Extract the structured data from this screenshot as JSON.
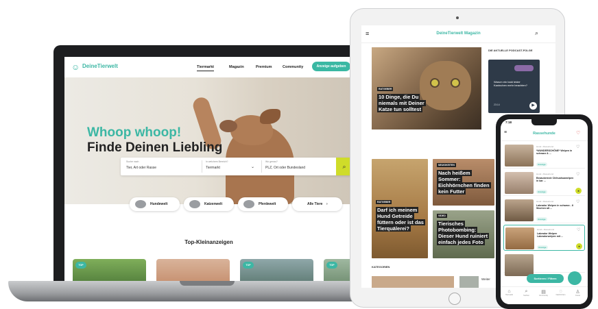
{
  "laptop": {
    "logo": "DeineTierwelt",
    "nav": [
      "Tiermarkt",
      "Magazin",
      "Premium",
      "Community"
    ],
    "cta": "Anzeige aufgeben",
    "hero": {
      "line1": "Whoop whoop!",
      "line2": "Finde Deinen Liebling"
    },
    "search": {
      "fields": [
        {
          "label": "Suche nach",
          "value": "Tier, Art oder Rasse"
        },
        {
          "label": "In welchem Bereich?",
          "value": "Tiermarkt"
        },
        {
          "label": "Wo genau?",
          "value": "PLZ, Ort oder Bundesland"
        }
      ],
      "button_icon": "search-icon"
    },
    "categories": [
      "Hundewelt",
      "Katzenwelt",
      "Pferdewelt",
      "Alle Tiere"
    ],
    "section_title": "Top-Kleinanzeigen",
    "thumb_badge": "TOP"
  },
  "tablet": {
    "title": "DeineTierwelt Magazin",
    "main_article": {
      "tag": "RATGEBER",
      "headline": "10 Dinge, die Du niemals mit Deiner Katze tun solltest"
    },
    "podcast": {
      "label": "DIE AKTUELLE PODCAST-FOLGE",
      "text": "Warum ein bald leider Kaninchen mehr beachten?",
      "time": "23:14"
    },
    "cards": [
      {
        "tag": "RATGEBER",
        "headline": "Darf ich meinem Hund Getreide füttern oder ist das Tierquälerei?"
      },
      {
        "tag": "NEUIGKEITEN",
        "headline": "Nach heißem Sommer: Eichhörnchen finden kein Futter"
      },
      {
        "tag": "VIDEO",
        "headline": "Tierisches Photobombing: Dieser Hund ruiniert einfach jedes Foto"
      }
    ],
    "categories_label": "KATEGORIEN",
    "bottom_text": "Weiter"
  },
  "phone": {
    "time": "7:18",
    "title": "Rassehunde",
    "items": [
      {
        "meta": "Hund • Rassehund",
        "text": "*WUNDERSCHÖNE* Welpen in schwarz & ...",
        "pill": "Anzeige",
        "highlight": false
      },
      {
        "meta": "Hund • Rassehund",
        "text": "Bezaubernde Chihuahuawelpen in bar ...",
        "pill": "Anzeige",
        "highlight": false
      },
      {
        "meta": "Hund • Rassehund",
        "text": "Labrador Welpen in schwarz - 8 Wochen alt ...",
        "pill": "Anzeige",
        "highlight": false
      },
      {
        "meta": "Hund • Rassehund",
        "text": "Labrador Welpen Labradorwelpen mit ...",
        "pill": "Anzeige",
        "highlight": true
      },
      {
        "meta": "Hund • Rassehund",
        "text": "",
        "pill": "",
        "highlight": false
      }
    ],
    "filter_button": "Sortieren / Filtern",
    "tabs": [
      "Tiermarkt",
      "Suchen",
      "Community",
      "Nachrichten",
      "Konto"
    ]
  },
  "colors": {
    "brand": "#3cb7a4",
    "accent": "#cfdc29",
    "heart": "#e0413f"
  }
}
